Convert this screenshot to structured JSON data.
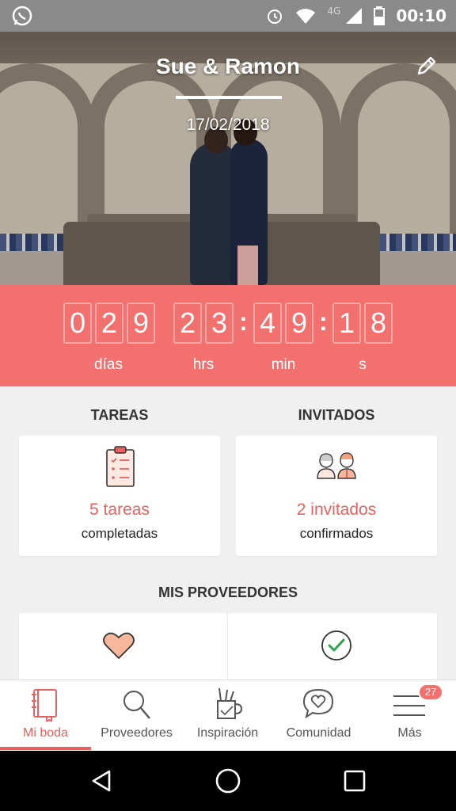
{
  "status_bar": {
    "time": "00:10",
    "network": "4G"
  },
  "wedding": {
    "couple_name": "Sue & Ramon",
    "date": "17/02/2018"
  },
  "countdown": {
    "days_digits": [
      "0",
      "2",
      "9"
    ],
    "hours_digits": [
      "2",
      "3"
    ],
    "minutes_digits": [
      "4",
      "9"
    ],
    "seconds_digits": [
      "1",
      "8"
    ],
    "days_label": "días",
    "hours_label": "hrs",
    "minutes_label": "min",
    "seconds_label": "s",
    "separator": ":"
  },
  "tasks": {
    "section_title": "TAREAS",
    "count_text": "5 tareas",
    "status_text": "completadas"
  },
  "guests": {
    "section_title": "INVITADOS",
    "count_text": "2 invitados",
    "status_text": "confirmados"
  },
  "vendors": {
    "section_title": "MIS PROVEEDORES"
  },
  "bottom_nav": {
    "items": [
      {
        "label": "Mi boda",
        "icon": "notebook-icon",
        "active": true
      },
      {
        "label": "Proveedores",
        "icon": "search-icon"
      },
      {
        "label": "Inspiración",
        "icon": "pencil-cup-icon"
      },
      {
        "label": "Comunidad",
        "icon": "chat-heart-icon"
      },
      {
        "label": "Más",
        "icon": "menu-icon"
      }
    ],
    "more_badge": "27"
  },
  "colors": {
    "accent": "#f2716f",
    "accent_text": "#e8615e",
    "background": "#f0f0f0"
  }
}
